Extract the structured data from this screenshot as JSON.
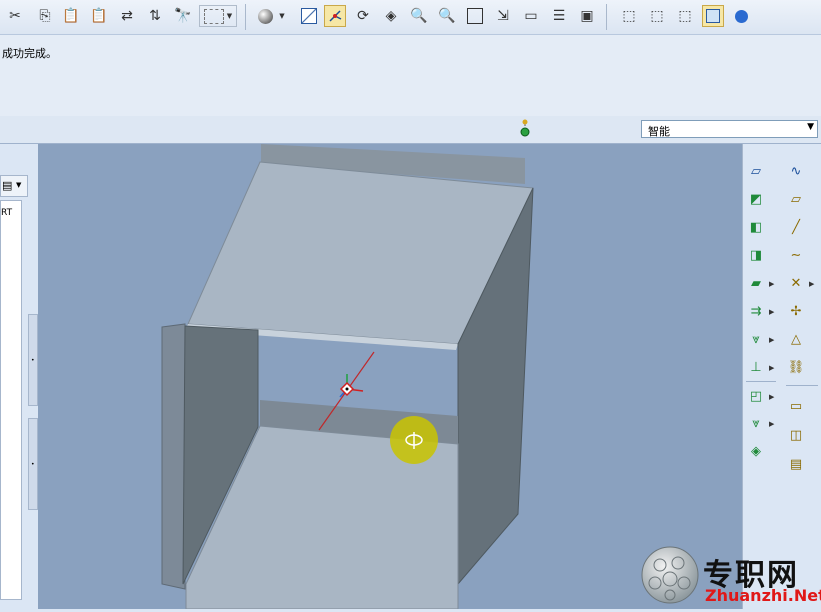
{
  "message_area": {
    "message": "成功完成。"
  },
  "status_bar": {
    "filter_selected": "智能"
  },
  "model_tree": {
    "visible_item_fragment": "RT"
  },
  "toolbar": {
    "icons": [
      "cut-icon",
      "copy-icon",
      "paste-icon",
      "paste-special-icon",
      "regenerate-icon",
      "regen-manager-icon",
      "find-icon",
      "select-box-icon",
      "shading-icon",
      "repaint-icon",
      "spin-center-icon",
      "view-manager-icon",
      "orient-mode-icon",
      "zoom-in-icon",
      "zoom-out-icon",
      "refit-icon",
      "reorient-icon",
      "saved-views-icon",
      "layers-icon",
      "display-style-icon",
      "wireframe-icon",
      "hidden-line-icon",
      "no-hidden-icon",
      "shaded-icon",
      "model-display-icon"
    ],
    "active_icons": [
      "view-manager-icon",
      "shaded-icon"
    ]
  },
  "right_toolbar": {
    "icons": [
      "plane-icon",
      "sketch-curve-icon",
      "wall-icon",
      "flat-wall-icon",
      "flange-icon",
      "datum-axis-icon",
      "twist-icon",
      "curve-icon",
      "extrude-icon",
      "point-icon",
      "unbend-icon",
      "coordinate-system-icon",
      "bend-back-icon",
      "analysis-icon",
      "form-icon",
      "csys-link-icon",
      "edge-rip-icon",
      "flat-pattern-icon",
      "corner-relief-icon",
      "offset-icon",
      "sheetmetal-convert-icon",
      "group-copy-icon"
    ]
  },
  "watermark": {
    "cn": "专职网",
    "en": "Zhuanzhi.Net"
  },
  "colors": {
    "viewport_bg": "#8aa1bf",
    "panel_face": "#a9b6c4",
    "panel_dark": "#66727a",
    "cursor_highlight": "#c9c400",
    "accent_green": "#1f8a3a"
  }
}
